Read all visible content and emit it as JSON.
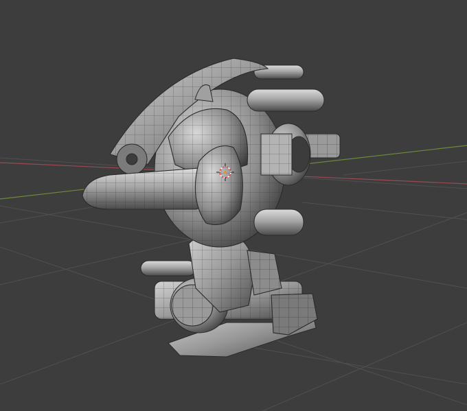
{
  "viewport": {
    "background_color": "#3d3d3d",
    "grid_color": "#505050",
    "x_axis_color": "#9b4a52",
    "y_axis_color": "#6e8a3a",
    "cursor_primary": "#e04040",
    "cursor_secondary": "#ffffff",
    "object_shade_light": "#c8c8c8",
    "object_shade_mid": "#8a8a8a",
    "object_shade_dark": "#4a4a4a",
    "wire_color": "#2a2a2a"
  },
  "object": {
    "icon": "robot-mech-icon"
  }
}
